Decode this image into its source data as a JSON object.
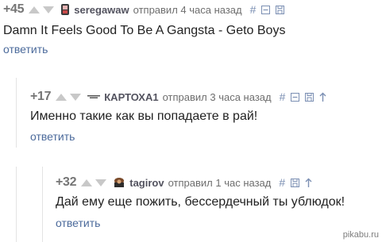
{
  "comments": [
    {
      "rating": "+45",
      "username": "seregawaw",
      "posted": "отправил 4 часа назад",
      "text": "Damn It Feels Good To Be A Gangsta - Geto Boys",
      "reply_label": "ответить",
      "hash": "#"
    },
    {
      "rating": "+17",
      "username": "КАРТОХА1",
      "posted": "отправил 3 часа назад",
      "text": "Именно такие как вы попадаете в рай!",
      "reply_label": "ответить",
      "hash": "#"
    },
    {
      "rating": "+32",
      "username": "tagirov",
      "posted": "отправил 1 час назад",
      "text": "Дай ему еще пожить, бессердечный ты ублюдок!",
      "reply_label": "ответить",
      "hash": "#"
    }
  ],
  "watermark": "pikabu.ru",
  "colors": {
    "vote_arrow": "#c8c8c8",
    "reply_link": "#4b6a9b",
    "tool_icons": "#7b8fb3",
    "thread_line": "#e3e3e3"
  }
}
